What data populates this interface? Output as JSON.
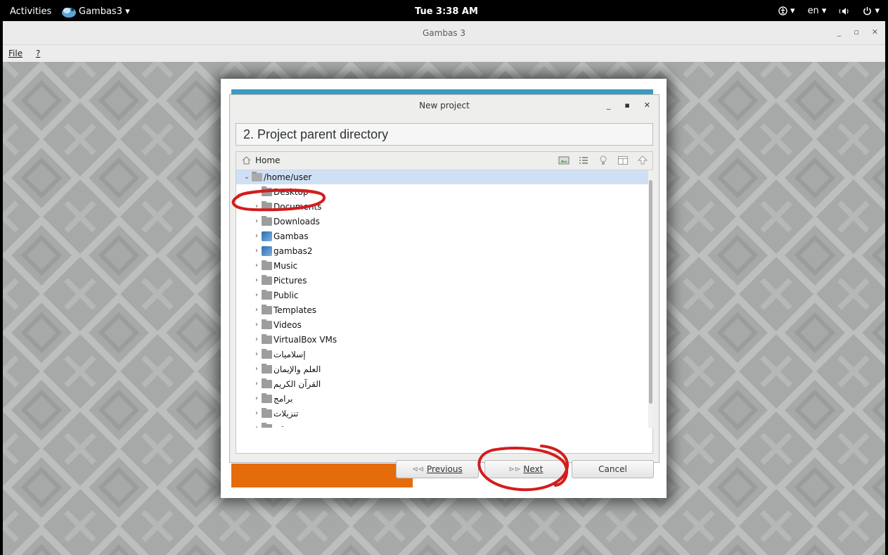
{
  "topbar": {
    "activities": "Activities",
    "app_menu": "Gambas3 ▾",
    "clock": "Tue  3:38 AM",
    "lang": "en ▾",
    "accessibility": "▾",
    "power": "▾"
  },
  "window": {
    "title": "Gambas 3",
    "menu": [
      "File",
      "?"
    ]
  },
  "dialog": {
    "title": "New project",
    "step": "2. Project parent directory",
    "toolbar": {
      "home_label": "Home"
    },
    "tree": [
      {
        "label": "/home/user",
        "expanded": true,
        "selected": true,
        "icon": "home-icon"
      },
      {
        "label": "Desktop",
        "icon": "folder-icon"
      },
      {
        "label": "Documents",
        "icon": "folder-icon"
      },
      {
        "label": "Downloads",
        "icon": "folder-icon"
      },
      {
        "label": "Gambas",
        "icon": "gambas-icon"
      },
      {
        "label": "gambas2",
        "icon": "gambas-icon"
      },
      {
        "label": "Music",
        "icon": "folder-icon"
      },
      {
        "label": "Pictures",
        "icon": "folder-icon"
      },
      {
        "label": "Public",
        "icon": "folder-icon"
      },
      {
        "label": "Templates",
        "icon": "folder-icon"
      },
      {
        "label": "Videos",
        "icon": "folder-icon"
      },
      {
        "label": "VirtualBox VMs",
        "icon": "folder-icon"
      },
      {
        "label": "إسلاميات",
        "icon": "folder-icon",
        "rtl": true
      },
      {
        "label": "العلم والإيمان",
        "icon": "folder-icon",
        "rtl": true
      },
      {
        "label": "القرآن الكريم",
        "icon": "folder-icon",
        "rtl": true
      },
      {
        "label": "برامج",
        "icon": "folder-icon",
        "rtl": true
      },
      {
        "label": "تنزيلات",
        "icon": "folder-icon",
        "rtl": true
      },
      {
        "label": "موسيقى",
        "icon": "folder-icon",
        "rtl": true
      }
    ],
    "buttons": {
      "previous": "Previous",
      "next": "Next",
      "cancel": "Cancel"
    }
  },
  "colors": {
    "accent_blue": "#3b9ac2",
    "accent_orange": "#e46c0a",
    "selection": "#cfe0f5",
    "annotation_red": "#d21d1d"
  }
}
